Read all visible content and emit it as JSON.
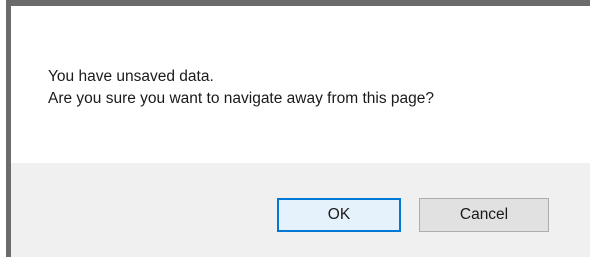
{
  "dialog": {
    "message_line_1": "You have unsaved data.",
    "message_line_2": "Are you sure you want to navigate away from this page?",
    "ok_label": "OK",
    "cancel_label": "Cancel"
  },
  "colors": {
    "frame": "#6b6b6b",
    "footer_background": "#f0f0f0",
    "focus_accent": "#0078d7"
  }
}
